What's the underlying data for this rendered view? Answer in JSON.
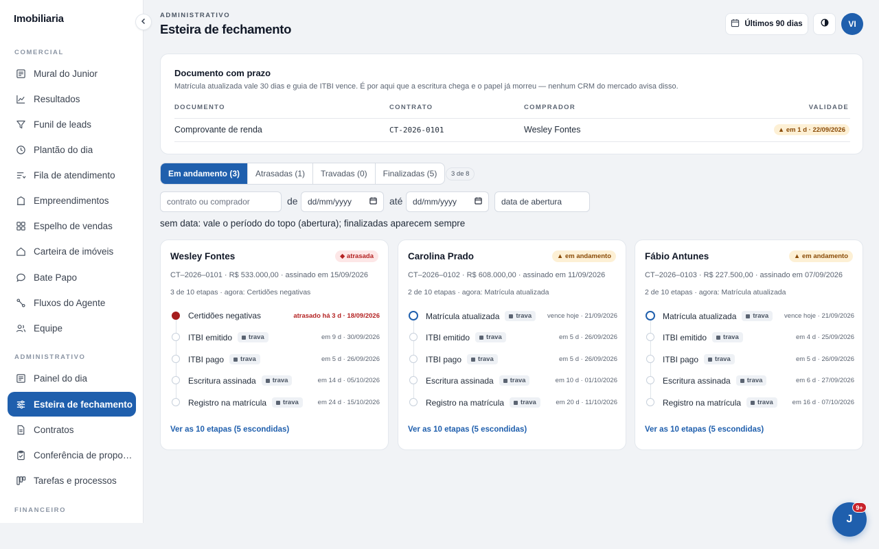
{
  "app": {
    "brand": "Imobiliaria"
  },
  "sidebar": {
    "sections": [
      {
        "label": "COMERCIAL"
      },
      {
        "label": "ADMINISTRATIVO"
      },
      {
        "label": "FINANCEIRO"
      }
    ],
    "items": [
      {
        "label": "Mural do Junior",
        "icon": "newspaper-icon"
      },
      {
        "label": "Resultados",
        "icon": "line-chart-icon"
      },
      {
        "label": "Funil de leads",
        "icon": "funnel-icon"
      },
      {
        "label": "Plantão do dia",
        "icon": "clock-icon"
      },
      {
        "label": "Fila de atendimento",
        "icon": "queue-icon"
      },
      {
        "label": "Empreendimentos",
        "icon": "building-icon"
      },
      {
        "label": "Espelho de vendas",
        "icon": "grid-icon"
      },
      {
        "label": "Carteira de imóveis",
        "icon": "house-icon"
      },
      {
        "label": "Bate Papo",
        "icon": "chat-icon"
      },
      {
        "label": "Fluxos do Agente",
        "icon": "flow-icon"
      },
      {
        "label": "Equipe",
        "icon": "users-icon"
      },
      {
        "label": "Painel do dia",
        "icon": "newspaper-icon"
      },
      {
        "label": "Esteira de fechamento",
        "icon": "sliders-icon",
        "active": true
      },
      {
        "label": "Contratos",
        "icon": "document-icon"
      },
      {
        "label": "Conferência de propostas",
        "icon": "clipboard-icon"
      },
      {
        "label": "Tarefas e processos",
        "icon": "kanban-icon"
      }
    ]
  },
  "header": {
    "eyebrow": "ADMINISTRATIVO",
    "title": "Esteira de fechamento",
    "period_label": "Últimos 90 dias",
    "avatar_initials": "VI"
  },
  "deadline": {
    "title": "Documento com prazo",
    "subtitle": "Matrícula atualizada vale 30 dias e guia de ITBI vence. É por aqui que a escritura chega e o papel já morreu — nenhum CRM do mercado avisa disso.",
    "columns": [
      "DOCUMENTO",
      "CONTRATO",
      "COMPRADOR",
      "VALIDADE"
    ],
    "row": {
      "document": "Comprovante de renda",
      "contract": "CT-2026-0101",
      "buyer": "Wesley Fontes",
      "validity": "▲ em 1 d · 22/09/2026"
    }
  },
  "tabs": [
    {
      "label": "Em andamento (3)",
      "active": true
    },
    {
      "label": "Atrasadas (1)"
    },
    {
      "label": "Travadas (0)"
    },
    {
      "label": "Finalizadas (5)"
    }
  ],
  "counter": "3 de 8",
  "filters": {
    "search_placeholder": "contrato ou comprador",
    "from_label": "de",
    "to_label": "até",
    "date_placeholder": "dd/mm/yyyy",
    "date_field": "data de abertura",
    "note": "sem data: vale o período do topo (abertura); finalizadas aparecem sempre"
  },
  "cards": [
    {
      "name": "Wesley Fontes",
      "status": "◆ atrasada",
      "status_kind": "late",
      "meta": "CT–2026–0101 · R$ 533.000,00 · assinado em 15/09/2026",
      "progress": "3 de 10 etapas · agora: Certidões negativas",
      "steps": [
        {
          "name": "Certidões negativas",
          "trava": false,
          "date": "atrasado há 3 d · 18/09/2026",
          "state": "late"
        },
        {
          "name": "ITBI emitido",
          "trava": true,
          "date": "em 9 d · 30/09/2026",
          "state": "pending"
        },
        {
          "name": "ITBI pago",
          "trava": true,
          "date": "em 5 d · 26/09/2026",
          "state": "pending"
        },
        {
          "name": "Escritura assinada",
          "trava": true,
          "date": "em 14 d · 05/10/2026",
          "state": "pending"
        },
        {
          "name": "Registro na matrícula",
          "trava": true,
          "date": "em 24 d · 15/10/2026",
          "state": "pending"
        }
      ],
      "see_all": "Ver as 10 etapas (5 escondidas)"
    },
    {
      "name": "Carolina Prado",
      "status": "▲ em andamento",
      "status_kind": "ok",
      "meta": "CT–2026–0102 · R$ 608.000,00 · assinado em 11/09/2026",
      "progress": "2 de 10 etapas · agora: Matrícula atualizada",
      "steps": [
        {
          "name": "Matrícula atualizada",
          "trava": true,
          "date": "vence hoje · 21/09/2026",
          "state": "current"
        },
        {
          "name": "ITBI emitido",
          "trava": true,
          "date": "em 5 d · 26/09/2026",
          "state": "pending"
        },
        {
          "name": "ITBI pago",
          "trava": true,
          "date": "em 5 d · 26/09/2026",
          "state": "pending"
        },
        {
          "name": "Escritura assinada",
          "trava": true,
          "date": "em 10 d · 01/10/2026",
          "state": "pending"
        },
        {
          "name": "Registro na matrícula",
          "trava": true,
          "date": "em 20 d · 11/10/2026",
          "state": "pending"
        }
      ],
      "see_all": "Ver as 10 etapas (5 escondidas)"
    },
    {
      "name": "Fábio Antunes",
      "status": "▲ em andamento",
      "status_kind": "ok",
      "meta": "CT–2026–0103 · R$ 227.500,00 · assinado em 07/09/2026",
      "progress": "2 de 10 etapas · agora: Matrícula atualizada",
      "steps": [
        {
          "name": "Matrícula atualizada",
          "trava": true,
          "date": "vence hoje · 21/09/2026",
          "state": "current"
        },
        {
          "name": "ITBI emitido",
          "trava": true,
          "date": "em 4 d · 25/09/2026",
          "state": "pending"
        },
        {
          "name": "ITBI pago",
          "trava": true,
          "date": "em 5 d · 26/09/2026",
          "state": "pending"
        },
        {
          "name": "Escritura assinada",
          "trava": true,
          "date": "em 6 d · 27/09/2026",
          "state": "pending"
        },
        {
          "name": "Registro na matrícula",
          "trava": true,
          "date": "em 16 d · 07/10/2026",
          "state": "pending"
        }
      ],
      "see_all": "Ver as 10 etapas (5 escondidas)"
    }
  ],
  "trava_label": "trava",
  "fab": {
    "label": "J",
    "badge": "9+"
  },
  "colors": {
    "accent": "#1f5fad",
    "late": "#b42323",
    "warning_bg": "#fdf0d5"
  }
}
